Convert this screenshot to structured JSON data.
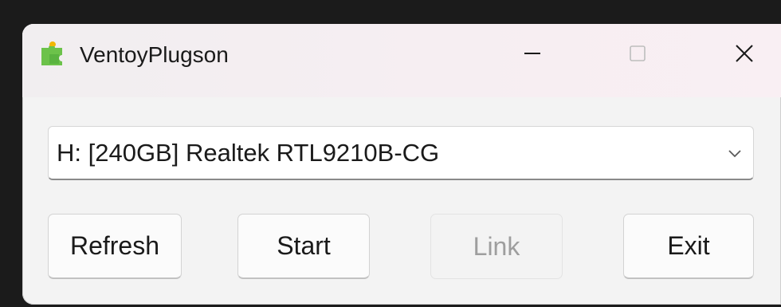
{
  "window": {
    "title": "VentoyPlugson",
    "icon": "puzzle-piece-icon",
    "controls": {
      "minimize_icon": "minimize-icon",
      "maximize_icon": "maximize-icon",
      "close_icon": "close-icon"
    }
  },
  "device_select": {
    "selected_value": "H: [240GB] Realtek RTL9210B-CG",
    "arrow_icon": "chevron-down-icon"
  },
  "buttons": {
    "refresh": "Refresh",
    "start": "Start",
    "link": "Link",
    "exit": "Exit"
  },
  "colors": {
    "icon_green": "#6cc24a",
    "icon_yellow": "#f2b705",
    "disabled_text": "#9e9e9e"
  }
}
